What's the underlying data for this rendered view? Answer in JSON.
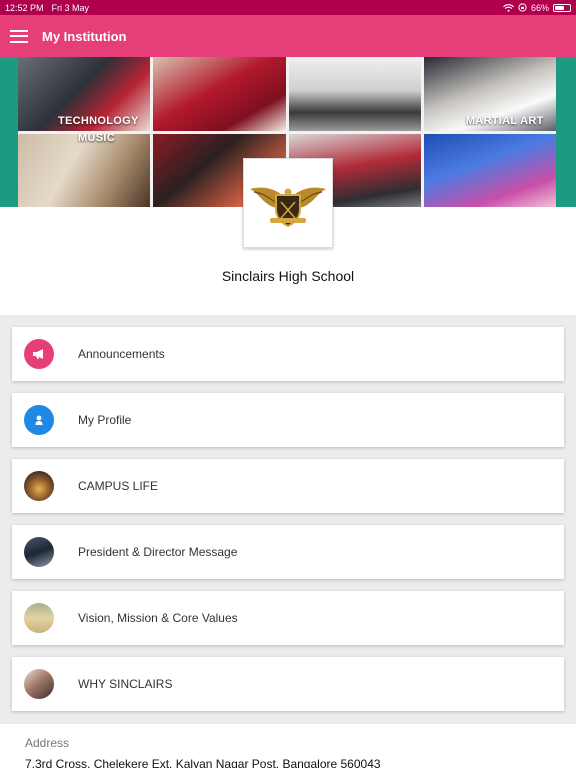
{
  "status_bar": {
    "time": "12:52 PM",
    "date": "Fri 3 May",
    "battery_text": "66%",
    "battery_level": 0.66
  },
  "app_bar": {
    "title": "My Institution",
    "menu_icon": "hamburger-menu-icon"
  },
  "banner": {
    "labels": [
      "TECHNOLOGY",
      "MARTIAL ART",
      "MUSIC"
    ]
  },
  "school": {
    "name": "Sinclairs High School"
  },
  "menu": [
    {
      "label": "Announcements",
      "icon": "megaphone-icon",
      "color": "#e63e79"
    },
    {
      "label": "My Profile",
      "icon": "user-icon",
      "color": "#1e88e5"
    },
    {
      "label": "CAMPUS LIFE",
      "icon": "campus-life-thumbnail"
    },
    {
      "label": "President & Director Message",
      "icon": "president-thumbnail"
    },
    {
      "label": "Vision, Mission & Core Values",
      "icon": "vision-thumbnail"
    },
    {
      "label": "WHY SINCLAIRS",
      "icon": "why-sinclairs-thumbnail"
    }
  ],
  "address": {
    "label": "Address",
    "text": "7,3rd Cross, Chelekere Ext, Kalyan Nagar Post, Bangalore 560043"
  },
  "colors": {
    "status_bar": "#b0004d",
    "app_bar": "#e63e79",
    "banner_edge": "#1e9a82",
    "profile_blue": "#1e88e5"
  }
}
